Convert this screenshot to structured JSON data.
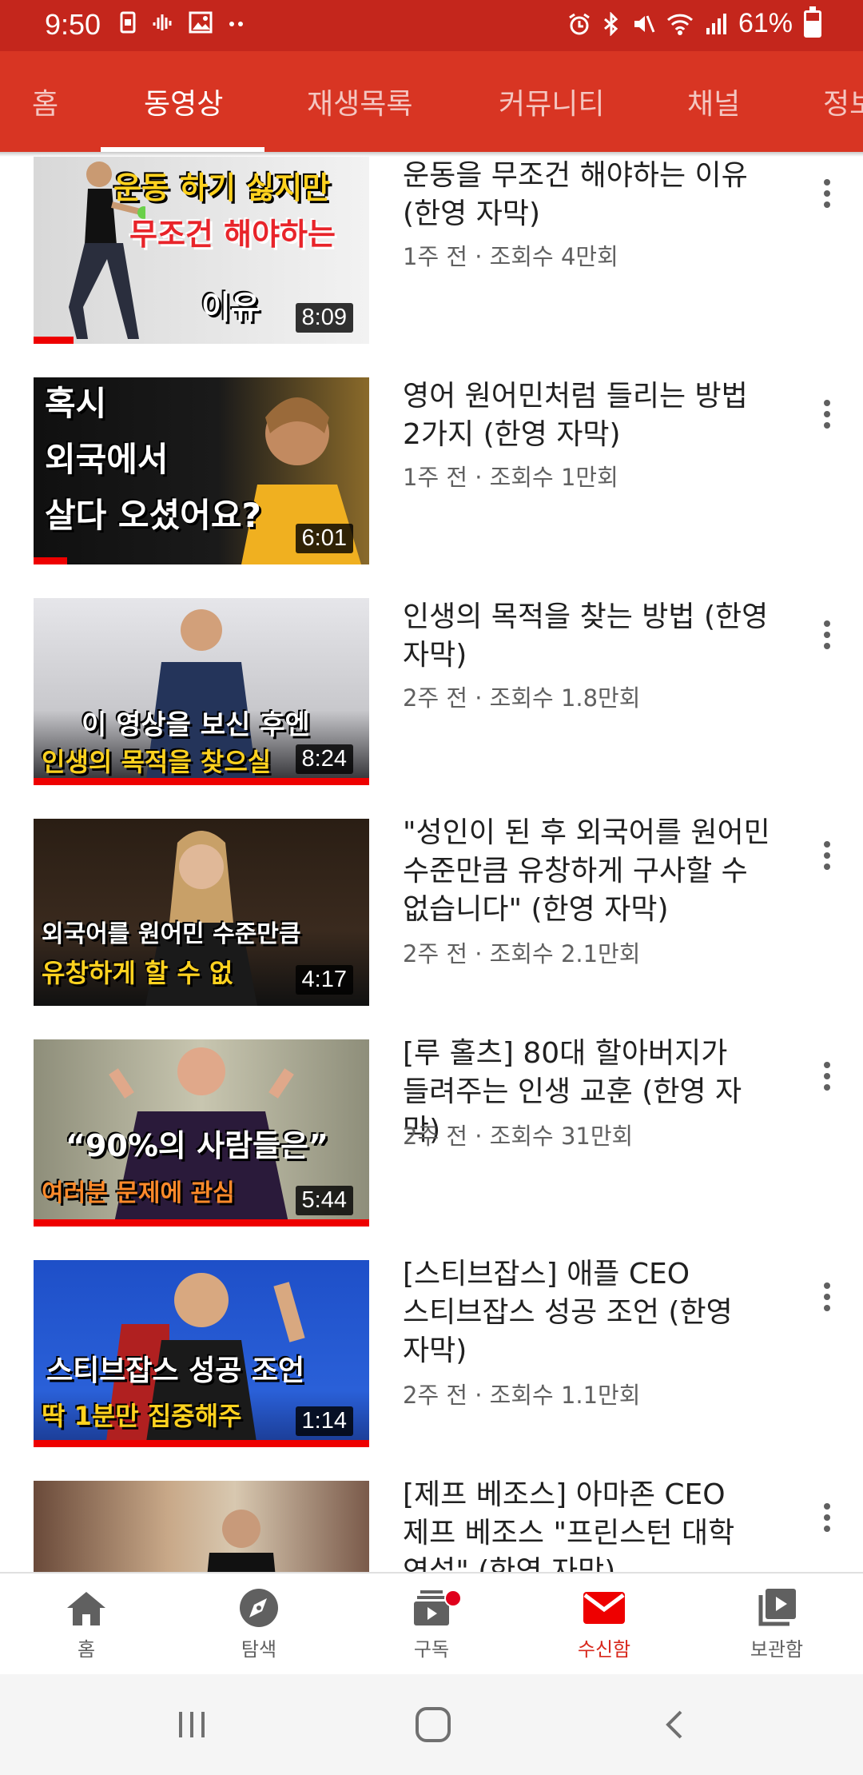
{
  "status_bar": {
    "time": "9:50",
    "left_icons": [
      "sim-icon",
      "voice-icon",
      "image-icon",
      "more-dots-icon"
    ],
    "battery": "61%",
    "battery_level": 0.61
  },
  "tabs": [
    {
      "label": "홈"
    },
    {
      "label": "동영상"
    },
    {
      "label": "재생목록"
    },
    {
      "label": "커뮤니티"
    },
    {
      "label": "채널"
    },
    {
      "label": "정보"
    }
  ],
  "active_tab": "동영상",
  "videos": [
    {
      "title_lines": [
        "운동을 무조건 해야하는 이유",
        "(한영 자막)"
      ],
      "meta": "1주 전 · 조회수 4만회",
      "duration": "8:09",
      "watched": 0.12,
      "thumb_lines": [
        "운동 하기 싫지만",
        "무조건 해야하는",
        "이유"
      ]
    },
    {
      "title_lines": [
        "영어 원어민처럼 들리는 방법",
        "2가지 (한영 자막)"
      ],
      "meta": "1주 전 · 조회수 1만회",
      "duration": "6:01",
      "watched": 0.1,
      "thumb_lines": [
        "혹시",
        "외국에서",
        "살다 오셨어요?"
      ]
    },
    {
      "title_lines": [
        "인생의 목적을 찾는 방법 (한영",
        "자막)"
      ],
      "meta": "2주 전 · 조회수 1.8만회",
      "duration": "8:24",
      "watched": 1,
      "thumb_lines": [
        "이 영상을 보신 후엔",
        "인생의 목적을 찾으실"
      ]
    },
    {
      "title_lines": [
        "\"성인이 된 후 외국어를 원어민",
        "수준만큼 유창하게 구사할 수",
        "없습니다\" (한영 자막)"
      ],
      "meta": "2주 전 · 조회수 2.1만회",
      "duration": "4:17",
      "watched": 0,
      "thumb_lines": [
        "외국어를 원어민 수준만큼",
        "유창하게 할 수 없"
      ]
    },
    {
      "title_lines": [
        "[루 홀츠] 80대 할아버지가",
        "들려주는 인생 교훈 (한영 자막)"
      ],
      "meta": "2주 전 · 조회수 31만회",
      "duration": "5:44",
      "watched": 1,
      "thumb_lines": [
        "“90%의 사람들은”",
        "여러분 문제에 관심"
      ]
    },
    {
      "title_lines": [
        "[스티브잡스] 애플 CEO",
        "스티브잡스 성공 조언 (한영",
        "자막)"
      ],
      "meta": "2주 전 · 조회수 1.1만회",
      "duration": "1:14",
      "watched": 1,
      "thumb_lines": [
        "스티브잡스 성공 조언",
        "딱 1분만 집중해주"
      ]
    },
    {
      "title_lines": [
        "[제프 베조스] 아마존 CEO",
        "제프 베조스 \"프린스턴 대학",
        "연설\" (한영 자막)"
      ],
      "meta": "",
      "duration": "",
      "watched": 0,
      "thumb_lines": []
    }
  ],
  "bottom_nav": [
    {
      "label": "홈",
      "icon": "home-icon"
    },
    {
      "label": "탐색",
      "icon": "compass-icon"
    },
    {
      "label": "구독",
      "icon": "subscriptions-icon"
    },
    {
      "label": "수신함",
      "icon": "inbox-icon"
    },
    {
      "label": "보관함",
      "icon": "library-icon"
    }
  ],
  "active_nav": "수신함",
  "colors": {
    "status_bar": "#c4261c",
    "tab_bar": "#d83523",
    "accent": "#d8281c",
    "progress": "#ee0000"
  }
}
